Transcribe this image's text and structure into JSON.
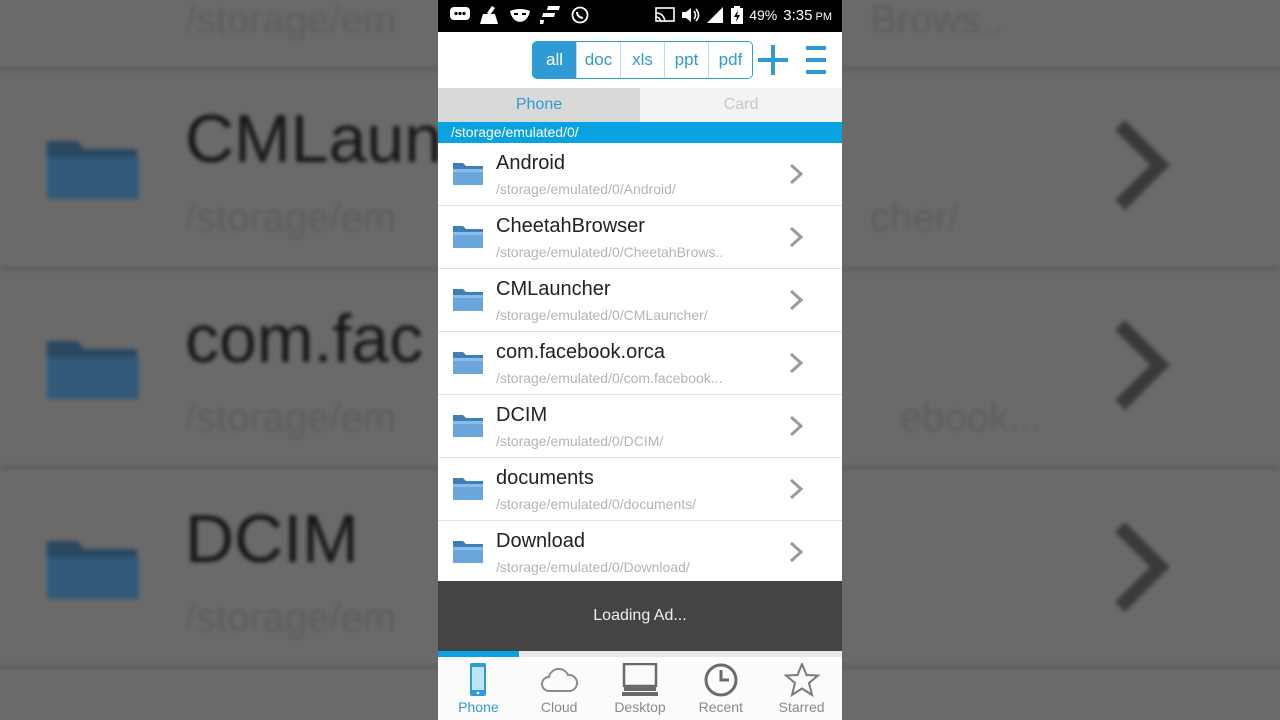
{
  "background": {
    "rows": [
      {
        "name": "CMLaun",
        "path": "/storage/em"
      },
      {
        "name": "com.fac",
        "path": "/storage/em"
      },
      {
        "name": "DCIM",
        "path": "/storage/em"
      }
    ],
    "top_path_right": "Brows..",
    "right_paths": [
      "cher/",
      "ebook..."
    ],
    "top_path_left": "/storage/em"
  },
  "status_bar": {
    "battery": "49%",
    "time": "3:35",
    "ampm": "PM",
    "icons": [
      "messenger-icon",
      "cleaner-icon",
      "mask-icon",
      "flipboard-icon",
      "whatsapp-icon",
      "cast-icon",
      "volume-icon",
      "signal-icon",
      "battery-icon"
    ]
  },
  "toolbar": {
    "filters": [
      "all",
      "doc",
      "xls",
      "ppt",
      "pdf"
    ],
    "active_filter": "all"
  },
  "tabs": {
    "phone": "Phone",
    "card": "Card"
  },
  "current_path": "/storage/emulated/0/",
  "folders": [
    {
      "name": "Android",
      "path": "/storage/emulated/0/Android/"
    },
    {
      "name": "CheetahBrowser",
      "path": "/storage/emulated/0/CheetahBrows.."
    },
    {
      "name": "CMLauncher",
      "path": "/storage/emulated/0/CMLauncher/"
    },
    {
      "name": "com.facebook.orca",
      "path": "/storage/emulated/0/com.facebook..."
    },
    {
      "name": "DCIM",
      "path": "/storage/emulated/0/DCIM/"
    },
    {
      "name": "documents",
      "path": "/storage/emulated/0/documents/"
    },
    {
      "name": "Download",
      "path": "/storage/emulated/0/Download/"
    }
  ],
  "ad_text": "Loading Ad...",
  "loading_progress": 0.2,
  "bottom_nav": {
    "phone": "Phone",
    "cloud": "Cloud",
    "desktop": "Desktop",
    "recent": "Recent",
    "starred": "Starred"
  },
  "colors": {
    "accent": "#2f9bd6",
    "path_bar": "#0aa3e2",
    "ad_bar": "#444444"
  }
}
